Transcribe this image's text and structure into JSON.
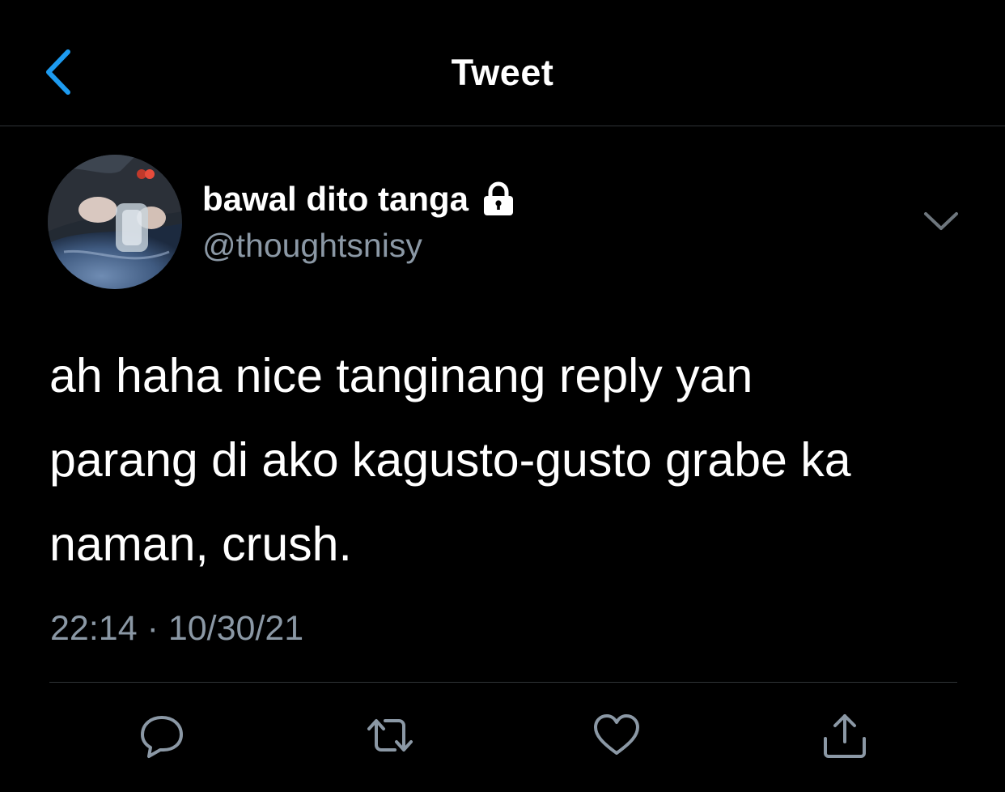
{
  "nav": {
    "title": "Tweet",
    "back_icon": "chevron-left-icon",
    "accent_color": "#1d9bf0"
  },
  "tweet": {
    "author": {
      "display_name": "bawal dito tanga",
      "handle": "@thoughtsnisy",
      "protected_icon": "lock-icon"
    },
    "text_lines": [
      "ah haha nice tanginang reply yan",
      "parang di ako kagusto-gusto grabe ka",
      "naman, crush."
    ],
    "time": "22:14",
    "separator": "·",
    "date": "10/30/21",
    "more_icon": "chevron-down-icon"
  },
  "actions": [
    {
      "name": "reply",
      "icon": "reply-icon"
    },
    {
      "name": "retweet",
      "icon": "retweet-icon"
    },
    {
      "name": "like",
      "icon": "heart-icon"
    },
    {
      "name": "share",
      "icon": "share-icon"
    }
  ],
  "colors": {
    "background": "#000000",
    "text": "#ffffff",
    "secondary_text": "#8b98a5",
    "divider": "#2f3336"
  }
}
